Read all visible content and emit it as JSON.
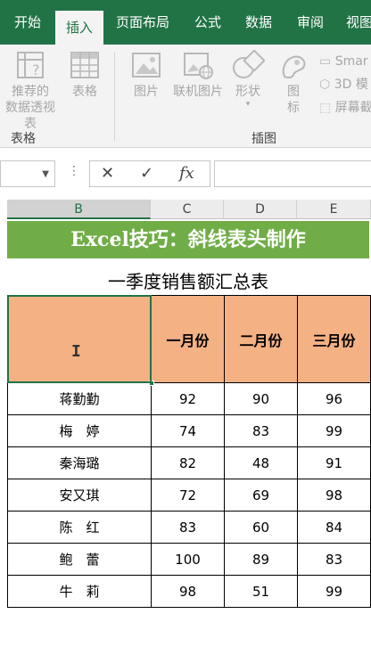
{
  "ribbon_tabs": [
    "开始",
    "插入",
    "页面布局",
    "公式",
    "数据",
    "审阅",
    "视图"
  ],
  "active_tab": "插入",
  "ribbon": {
    "pivot_label_line1": "推荐的",
    "pivot_label_line2": "数据透视表",
    "table_label": "表格",
    "group_tables": "表格",
    "picture_label": "图片",
    "online_picture_label": "联机图片",
    "shapes_label": "形状",
    "icons_label_line1": "图",
    "icons_label_line2": "标",
    "smartart_label": "Smar",
    "model3d_label": "3D 模",
    "screenshot_label": "屏幕截",
    "group_illustrations": "插图"
  },
  "formula_bar": {
    "name_box": "",
    "cancel_symbol": "✕",
    "enter_symbol": "✓",
    "fx_symbol": "fx",
    "formula": ""
  },
  "columns": [
    "B",
    "C",
    "D",
    "E"
  ],
  "selected_column": "B",
  "sheet": {
    "banner": "Excel技巧：斜线表头制作",
    "subtitle": "一季度销售额汇总表",
    "header_months": [
      "一月份",
      "二月份",
      "三月份"
    ],
    "cursor_glyph": "I",
    "rows": [
      {
        "name": "蒋勤勤",
        "m1": "92",
        "m2": "90",
        "m3": "96"
      },
      {
        "name": "梅　婷",
        "m1": "74",
        "m2": "83",
        "m3": "99"
      },
      {
        "name": "秦海璐",
        "m1": "82",
        "m2": "48",
        "m3": "91"
      },
      {
        "name": "安又琪",
        "m1": "72",
        "m2": "69",
        "m3": "98"
      },
      {
        "name": "陈　红",
        "m1": "83",
        "m2": "60",
        "m3": "84"
      },
      {
        "name": "鲍　蕾",
        "m1": "100",
        "m2": "89",
        "m3": "83"
      },
      {
        "name": "牛　莉",
        "m1": "98",
        "m2": "51",
        "m3": "99"
      }
    ]
  },
  "colors": {
    "excel_green": "#217346",
    "banner_green": "#70ad47",
    "header_orange": "#f4b183"
  }
}
